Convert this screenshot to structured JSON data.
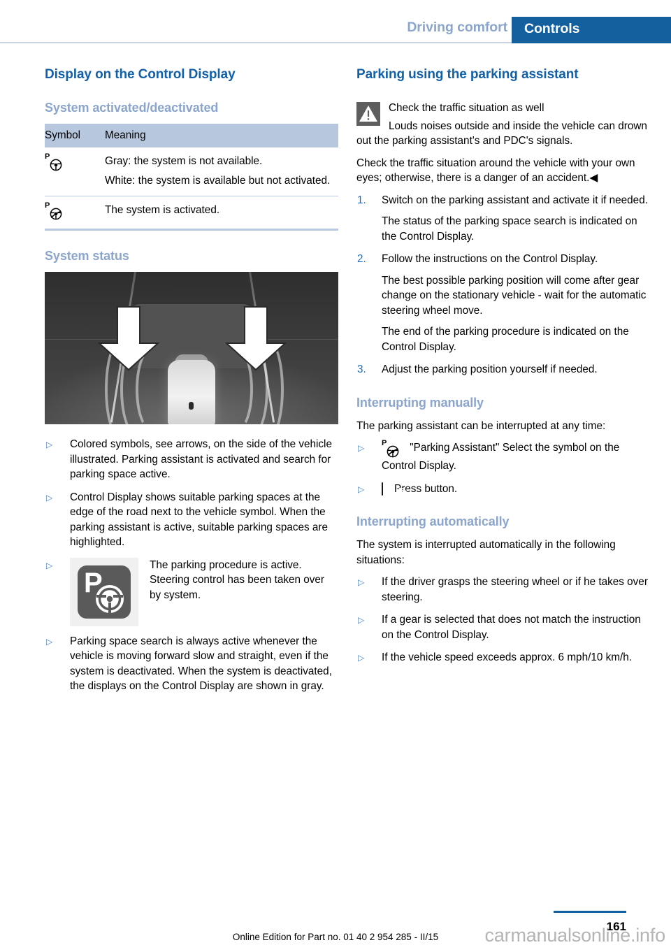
{
  "header": {
    "chapter": "Driving comfort",
    "section": "Controls"
  },
  "left_column": {
    "title": "Display on the Control Display",
    "subtitle_1": "System activated/deactivated",
    "table": {
      "columns": [
        "Symbol",
        "Meaning"
      ],
      "rows": [
        {
          "symbol_icon": "parking-steering-wheel-icon",
          "meaning_lines": [
            "Gray: the system is not available.",
            "White: the system is available but not activated."
          ]
        },
        {
          "symbol_icon": "parking-steering-wheel-active-icon",
          "meaning_lines": [
            "The system is activated."
          ]
        }
      ]
    },
    "subtitle_2": "System status",
    "illustration_alt": "Top view of vehicle on road with two white arrows pointing to parking space symbols",
    "bullets": [
      "Colored symbols, see arrows, on the side of the vehicle illustrated. Parking assistant is activated and search for parking space active.",
      "Control Display shows suitable parking spaces at the edge of the road next to the vehicle symbol. When the parking assistant is active, suitable parking spaces are highlighted.",
      "Parking space search is always active whenever the vehicle is moving forward slow and straight, even if the system is deactivated. When the system is deactivated, the displays on the Control Display are shown in gray."
    ],
    "icon_bullet": {
      "icon": "parking-active-steering-icon",
      "text": "The parking procedure is active. Steering control has been taken over by system."
    }
  },
  "right_column": {
    "title": "Parking using the parking assistant",
    "warning": {
      "icon": "warning-triangle-icon",
      "heading": "Check the traffic situation as well",
      "body": "Louds noises outside and inside the vehicle can drown out the parking assistant's and PDC's signals.",
      "paragraph": "Check the traffic situation around the vehicle with your own eyes; otherwise, there is a danger of an accident.◀"
    },
    "steps": [
      {
        "number": "1.",
        "text": "Switch on the parking assistant and activate it if needed.",
        "sub": "The status of the parking space search is indicated on the Control Display."
      },
      {
        "number": "2.",
        "text": "Follow the instructions on the Control Display.",
        "sub": "The best possible parking position will come after gear change on the stationary vehicle - wait for the automatic steering wheel move.",
        "sub2": "The end of the parking procedure is indicated on the Control Display."
      },
      {
        "number": "3.",
        "text": "Adjust the parking position yourself if needed."
      }
    ],
    "subtitle_manual": "Interrupting manually",
    "manual_intro": "The parking assistant can be interrupted at any time:",
    "manual_bullets": [
      {
        "icon": "parking-steering-wheel-active-icon",
        "text": "\"Parking Assistant\" Select the symbol on the Control Display."
      },
      {
        "icon": "pdc-button-icon",
        "text": "Press button."
      }
    ],
    "subtitle_auto": "Interrupting automatically",
    "auto_intro": "The system is interrupted automatically in the following situations:",
    "auto_bullets": [
      "If the driver grasps the steering wheel or if he takes over steering.",
      "If a gear is selected that does not match the instruction on the Control Display.",
      "If the vehicle speed exceeds approx. 6 mph/10 km/h."
    ]
  },
  "footer": {
    "edition": "Online Edition for Part no. 01 40 2 954 285 - II/15",
    "page_number": "161",
    "watermark": "carmanualsonline.info"
  },
  "colors": {
    "accent_blue": "#14609f",
    "title_blue": "#1260a8",
    "subtitle_blue": "#8ba5cc",
    "table_band": "#b6c7de",
    "bullet_blue": "#4a82c4"
  }
}
